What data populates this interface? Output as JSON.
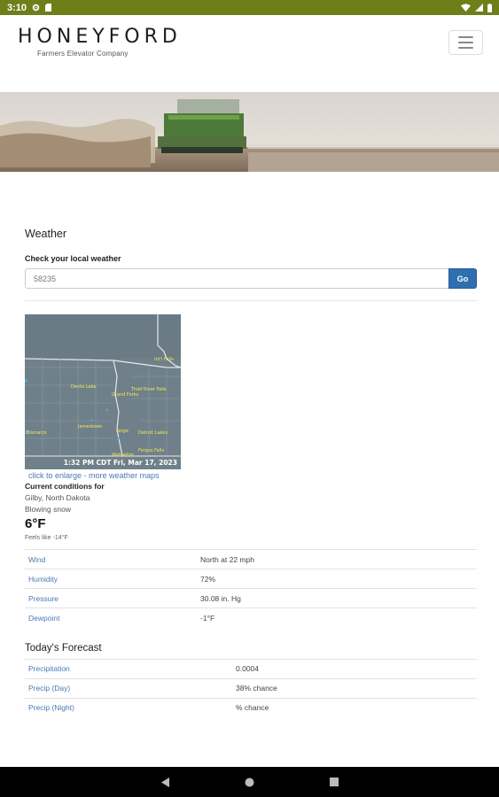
{
  "status_bar": {
    "time": "3:10"
  },
  "header": {
    "logo_text": "HONEYFORD",
    "logo_subtitle": "Farmers Elevator Company"
  },
  "weather": {
    "title": "Weather",
    "check_label": "Check your local weather",
    "zip_value": "58235",
    "go_label": "Go",
    "map": {
      "timestamp": "1:32 PM CDT Fri, Mar 17, 2023",
      "cities": [
        "Devils Lake",
        "Thief River Falls",
        "Grand Forks",
        "Jamestown",
        "Fargo",
        "Detroit Lakes",
        "Bismarck",
        "Fergus Falls",
        "Wahpeton",
        "Int'l Falls"
      ]
    },
    "link_enlarge": "click to enlarge",
    "link_more": "- more weather maps",
    "conditions_label": "Current conditions for",
    "location": "Gilby, North Dakota",
    "description": "Blowing snow",
    "temperature": "6°F",
    "feels_like": "Feels like -14°F",
    "conditions": [
      {
        "label": "Wind",
        "value": "North at 22 mph"
      },
      {
        "label": "Humidity",
        "value": "72%"
      },
      {
        "label": "Pressure",
        "value": "30.08 in. Hg"
      },
      {
        "label": "Dewpoint",
        "value": "-1°F"
      }
    ],
    "forecast_title": "Today's Forecast",
    "forecast": [
      {
        "label": "Precipitation",
        "value": "0.0004"
      },
      {
        "label": "Precip (Day)",
        "value": "38% chance"
      },
      {
        "label": "Precip (Night)",
        "value": "% chance"
      }
    ]
  },
  "colors": {
    "status_bar": "#6e7f1a",
    "link": "#4a79b5",
    "go_button": "#2f6fb0"
  }
}
